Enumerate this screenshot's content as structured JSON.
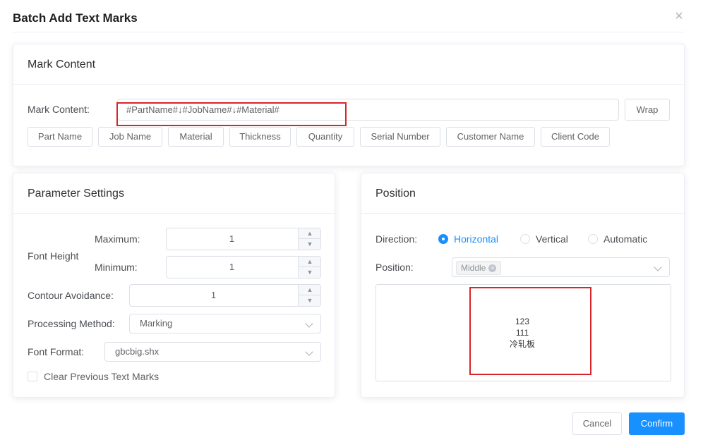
{
  "dialog": {
    "title": "Batch Add Text Marks",
    "close_glyph": "×"
  },
  "mark_content_card": {
    "heading": "Mark Content",
    "field_label": "Mark Content:",
    "field_value": "#PartName#↓#JobName#↓#Material#",
    "wrap_label": "Wrap",
    "tags": [
      "Part Name",
      "Job Name",
      "Material",
      "Thickness",
      "Quantity",
      "Serial Number",
      "Customer Name",
      "Client Code"
    ]
  },
  "parameter_card": {
    "heading": "Parameter Settings",
    "font_height_label": "Font Height",
    "maximum_label": "Maximum:",
    "maximum_value": "1",
    "minimum_label": "Minimum:",
    "minimum_value": "1",
    "contour_label": "Contour Avoidance:",
    "contour_value": "1",
    "processing_label": "Processing Method:",
    "processing_value": "Marking",
    "font_format_label": "Font Format:",
    "font_format_value": "gbcbig.shx",
    "clear_label": "Clear Previous Text Marks",
    "clear_checked": false
  },
  "position_card": {
    "heading": "Position",
    "direction_label": "Direction:",
    "directions": [
      {
        "label": "Horizontal",
        "selected": true
      },
      {
        "label": "Vertical",
        "selected": false
      },
      {
        "label": "Automatic",
        "selected": false
      }
    ],
    "position_label": "Position:",
    "position_tag": "Middle",
    "preview_lines": [
      "123",
      "111",
      "冷轧板"
    ]
  },
  "footer": {
    "cancel_label": "Cancel",
    "confirm_label": "Confirm"
  },
  "colors": {
    "primary": "#1890ff",
    "highlight_box": "#d9252b"
  },
  "icons": {
    "close": "close-icon",
    "spinner_up": "chevron-up-icon",
    "spinner_down": "chevron-down-icon",
    "select_arrow": "chevron-down-icon"
  }
}
